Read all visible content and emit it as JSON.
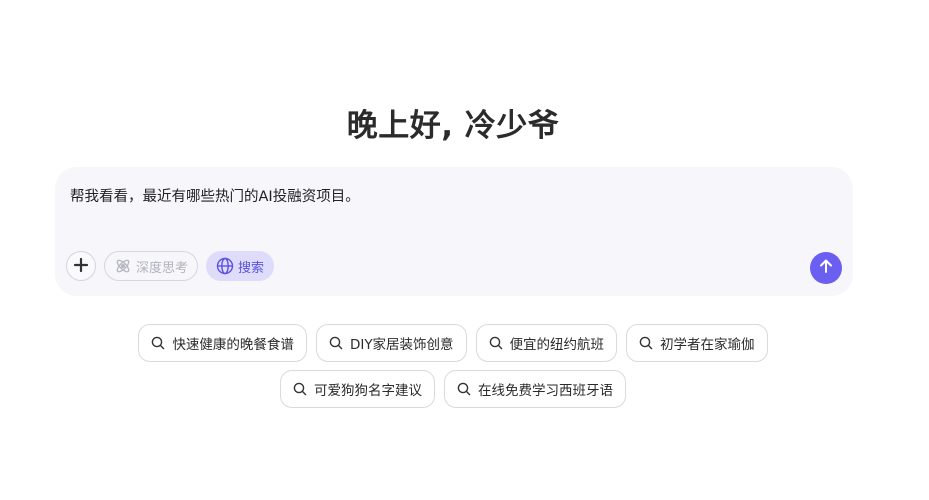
{
  "greeting": "晚上好, 冷少爷",
  "composer": {
    "prompt_text": "帮我看看，最近有哪些热门的AI投融资项目。",
    "tools": {
      "add_icon": "plus-icon",
      "deep_think_label": "深度思考",
      "deep_think_icon": "atom-icon",
      "search_label": "搜索",
      "search_icon": "globe-icon"
    },
    "send_icon": "arrow-up-icon"
  },
  "suggestions": [
    "快速健康的晚餐食谱",
    "DIY家居装饰创意",
    "便宜的纽约航班",
    "初学者在家瑜伽",
    "可爱狗狗名字建议",
    "在线免费学习西班牙语"
  ],
  "colors": {
    "accent": "#6a5ff0",
    "search_pill_bg": "#dedcfa",
    "composer_bg": "#f6f6fb"
  }
}
